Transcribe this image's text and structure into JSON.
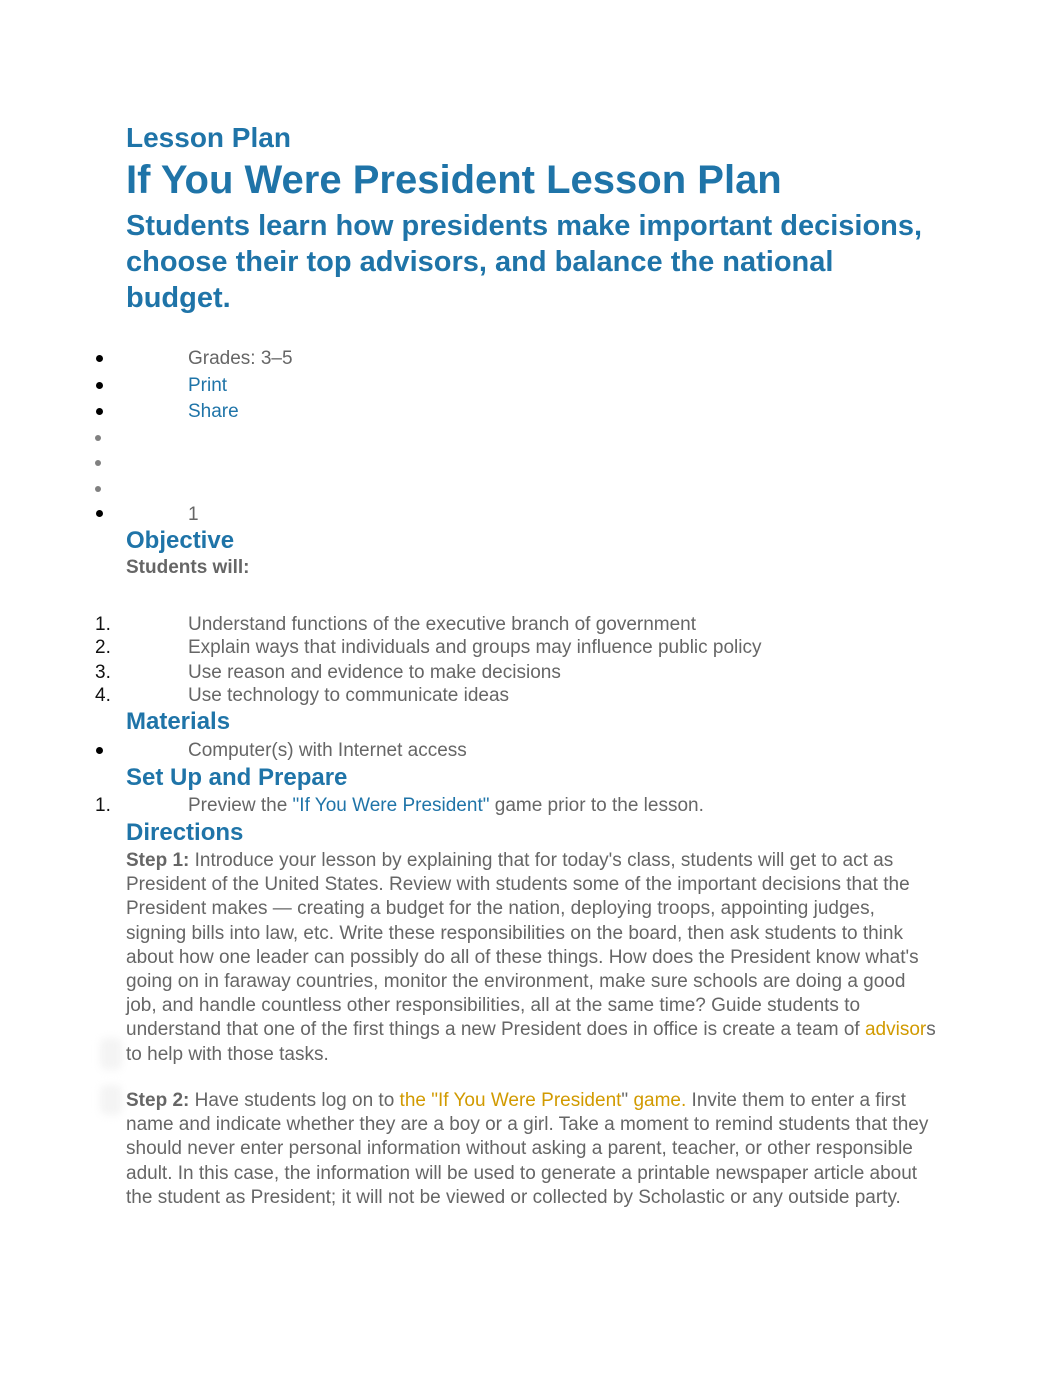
{
  "header": {
    "kicker": "Lesson Plan",
    "title": "If You Were President Lesson Plan",
    "subtitle": "Students learn how presidents make important decisions, choose their top advisors, and balance the national budget."
  },
  "meta_list": {
    "grades": "Grades: 3–5",
    "print_label": "Print",
    "share_label": "Share",
    "count": "1"
  },
  "objective": {
    "heading": "Objective",
    "intro": "Students will:",
    "items": [
      "Understand functions of the executive branch of government",
      "Explain ways that individuals and groups may influence public policy",
      "Use reason and evidence to make decisions",
      "Use technology to communicate ideas"
    ]
  },
  "materials": {
    "heading": "Materials",
    "items": [
      "Computer(s) with Internet access"
    ]
  },
  "setup": {
    "heading": "Set Up and Prepare",
    "item_prefix": "Preview the ",
    "item_link": "\"If You Were President\"",
    "item_suffix": " game prior to the lesson."
  },
  "directions": {
    "heading": "Directions",
    "step1": {
      "label": "Step 1:",
      "text_before": " Introduce your lesson by explaining that for today's class, students will get to act as President of the United States. Review with students some of the important decisions that the President makes — creating a budget for the nation, deploying troops, appointing judges, signing bills into law, etc. Write these responsibilities on the board, then ask students to think about how one leader can possibly do all of these things. How does the President know what's going on in faraway countries, monitor the environment, make sure schools are doing a good job, and handle countless other responsibilities, all at the same time? Guide students to understand that one of the first things a new President does in office is create a team of ",
      "link": "advisor",
      "text_after": "s to help with those tasks."
    },
    "step2": {
      "label": "Step 2:",
      "text_before": " Have students log on to ",
      "link_part1": "the \"",
      "link_part2": "If You Were President",
      "link_part3": "\"",
      "link_part4": " game.",
      "text_after": " Invite them to enter a first name and indicate whether they are a boy or a girl. Take a moment to remind students that they should never enter personal information without asking a parent, teacher, or other responsible adult. In this case, the information will be used to generate a printable newspaper article about the student as President; it will not be viewed or collected by Scholastic or any outside party."
    }
  },
  "colors": {
    "heading_blue": "#1f74a8",
    "body_grey": "#666666",
    "link_gold": "#d19a00"
  }
}
